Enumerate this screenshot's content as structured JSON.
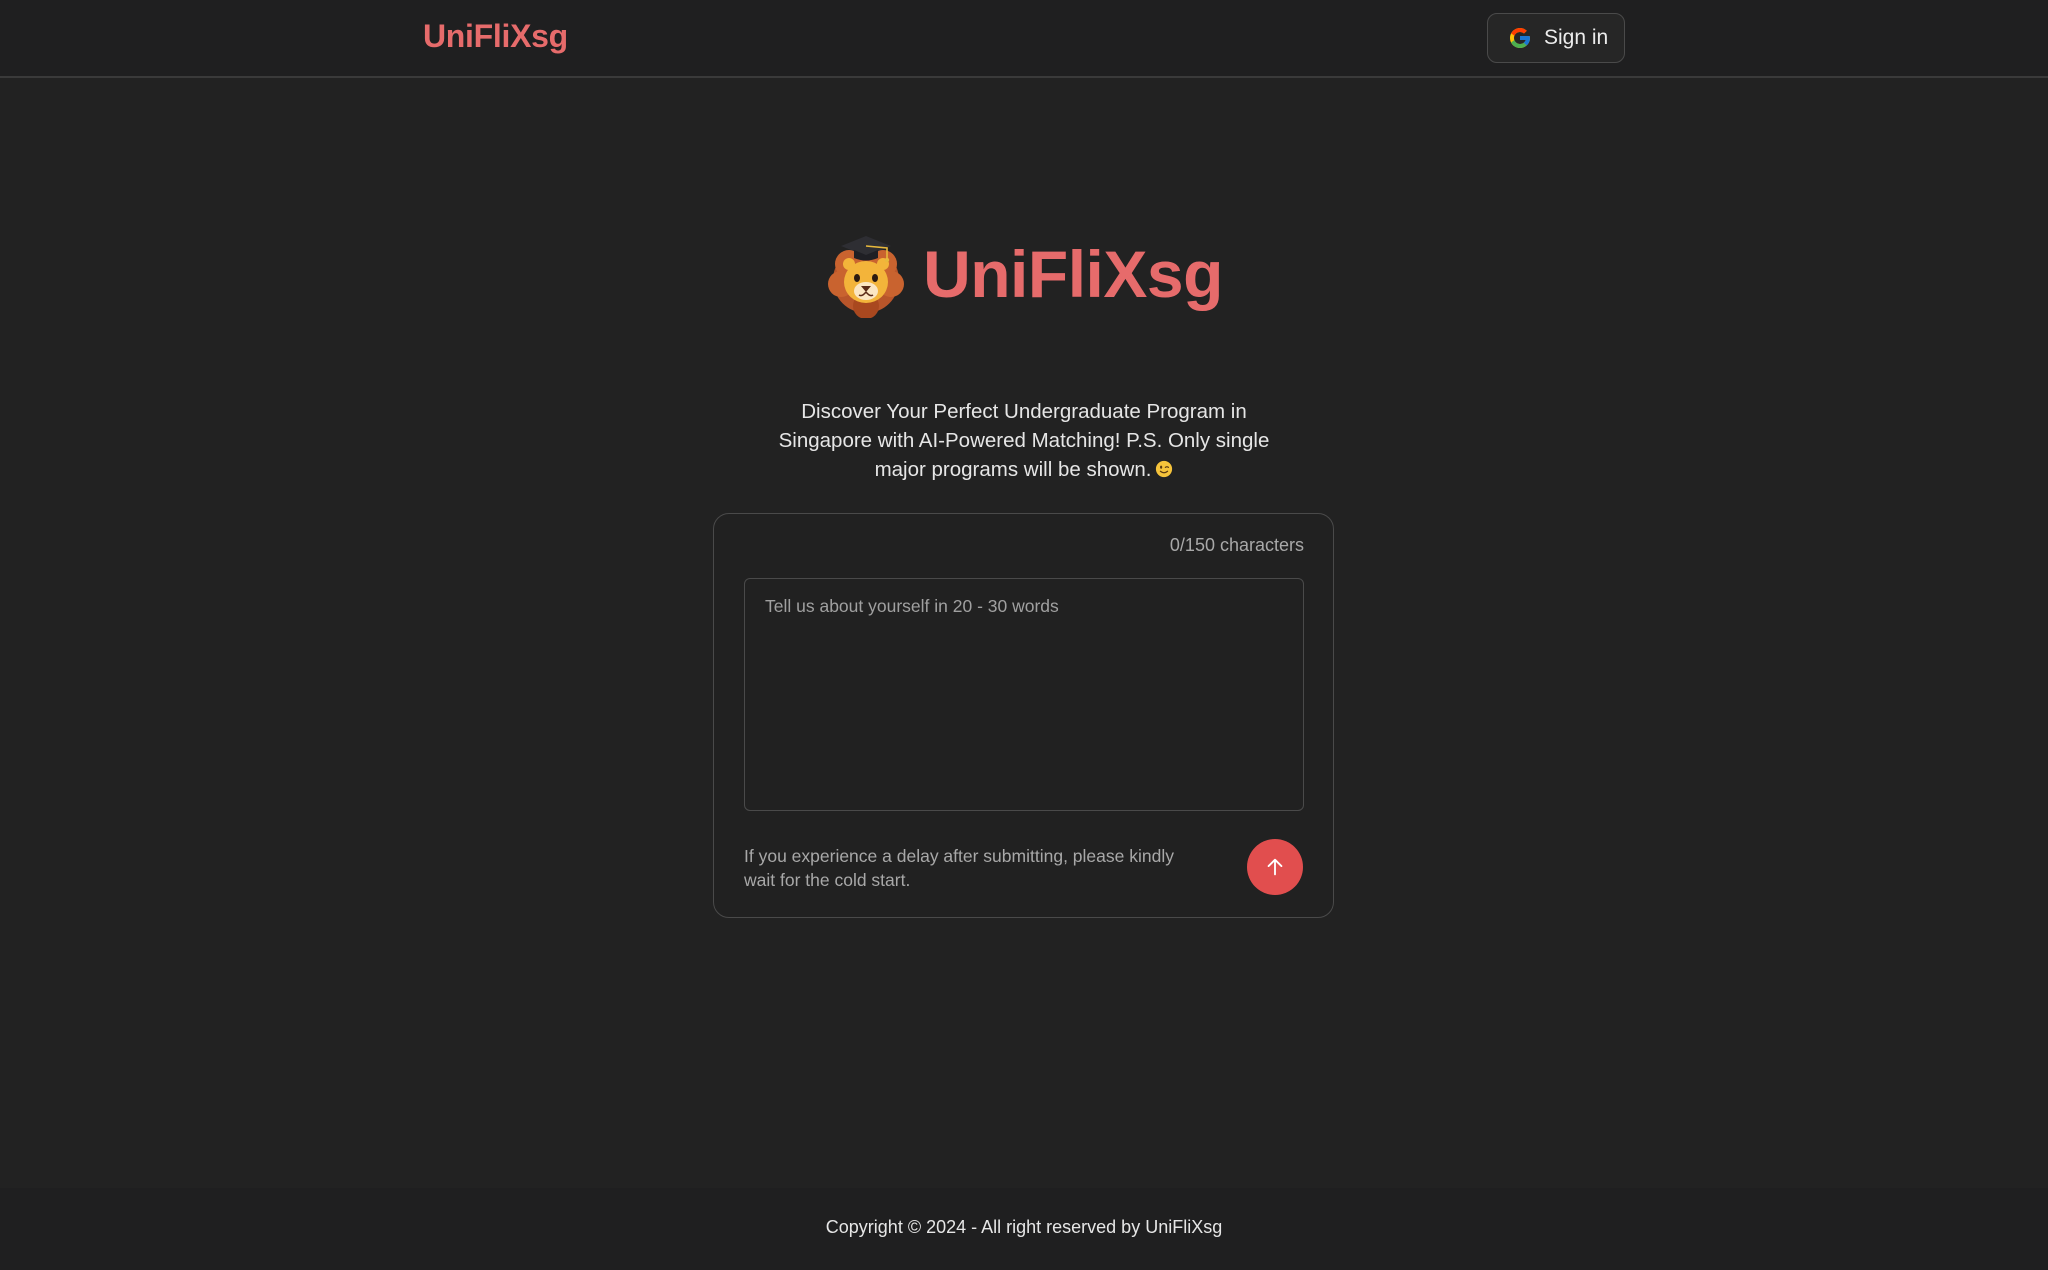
{
  "navbar": {
    "brand": "UniFliXsg",
    "signin_label": "Sign in",
    "signin_icon": "google-icon"
  },
  "hero": {
    "mascot_icon": "lion-graduate-icon",
    "title": "UniFliXsg",
    "subtitle": "Discover Your Perfect Undergraduate Program in Singapore with AI-Powered Matching! P.S. Only single major programs will be shown.",
    "subtitle_emoji": "winking-face-icon"
  },
  "form": {
    "char_count": "0/150 characters",
    "textarea_value": "",
    "textarea_placeholder": "Tell us about yourself in 20 - 30 words",
    "delay_note": "If you experience a delay after submitting, please kindly wait for the cold start.",
    "submit_icon": "arrow-up-icon"
  },
  "footer": {
    "copyright": "Copyright © 2024 - All right reserved by UniFliXsg"
  },
  "colors": {
    "accent": "#e66b6b",
    "submit": "#e14e4e",
    "background": "#222222"
  }
}
